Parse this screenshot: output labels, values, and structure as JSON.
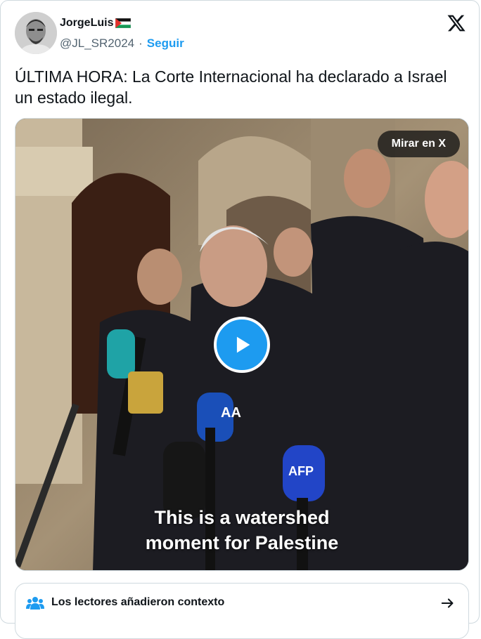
{
  "author": {
    "name": "JorgeLuis",
    "handle": "@JL_SR2024",
    "separator": "·",
    "follow_label": "Seguir",
    "flag_icon": "palestine-flag-icon"
  },
  "tweet": {
    "text": "ÚLTIMA HORA: La Corte Internacional ha declarado a Israel un estado ilegal."
  },
  "video": {
    "watch_label": "Mirar en X",
    "caption_line1": "This is a watershed",
    "caption_line2": "moment for Palestine",
    "play_icon": "play-icon",
    "mic_labels": [
      "AA",
      "AFP"
    ]
  },
  "community_note": {
    "label": "Los lectores añadieron contexto",
    "icon": "people-icon",
    "arrow_icon": "arrow-right-icon"
  },
  "colors": {
    "accent": "#1d9bf0",
    "text": "#0f1419",
    "secondary_text": "#536471",
    "border": "#cfd9de"
  }
}
